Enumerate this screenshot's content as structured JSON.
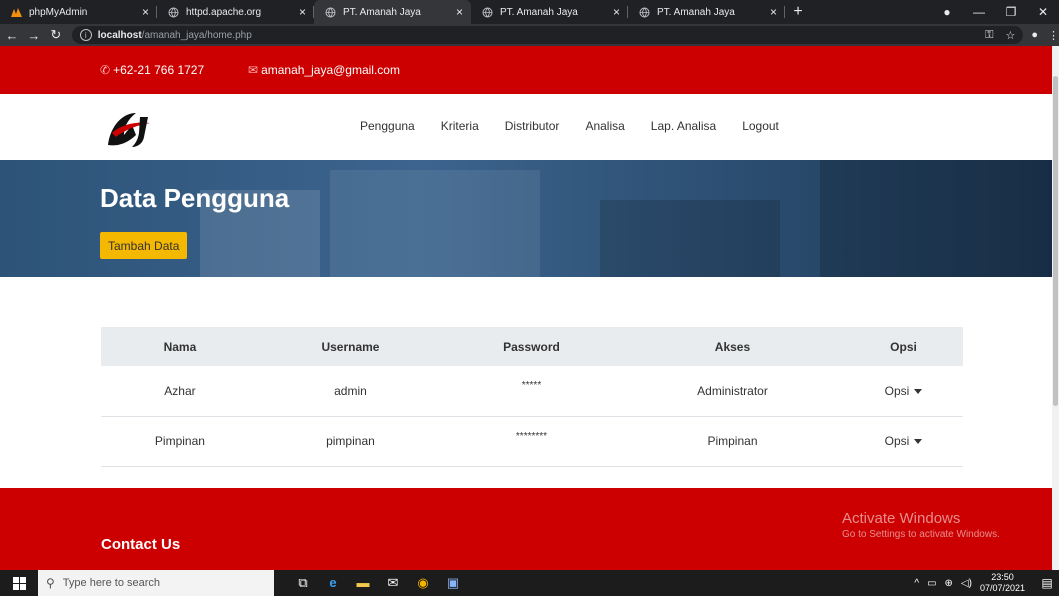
{
  "browser": {
    "tabs": [
      {
        "title": "phpMyAdmin",
        "icon": "phpmyadmin-icon",
        "active": false
      },
      {
        "title": "httpd.apache.org",
        "icon": "globe-icon",
        "active": false
      },
      {
        "title": "PT. Amanah Jaya",
        "icon": "globe-icon",
        "active": true
      },
      {
        "title": "PT. Amanah Jaya",
        "icon": "globe-icon",
        "active": false
      },
      {
        "title": "PT. Amanah Jaya",
        "icon": "globe-icon",
        "active": false
      }
    ],
    "close_glyph": "×",
    "new_tab_glyph": "+",
    "address": {
      "host": "localhost",
      "path": "/amanah_jaya/home.php"
    }
  },
  "site": {
    "phone": "+62-21 766 1727",
    "email": "amanah_jaya@gmail.com",
    "menu": [
      "Pengguna",
      "Kriteria",
      "Distributor",
      "Analisa",
      "Lap. Analisa",
      "Logout"
    ],
    "hero_title": "Data Pengguna",
    "add_button": "Tambah Data",
    "table": {
      "headers": [
        "Nama",
        "Username",
        "Password",
        "Akses",
        "Opsi"
      ],
      "rows": [
        {
          "nama": "Azhar",
          "username": "admin",
          "password": "*****",
          "akses": "Administrator",
          "opsi": "Opsi"
        },
        {
          "nama": "Pimpinan",
          "username": "pimpinan",
          "password": "********",
          "akses": "Pimpinan",
          "opsi": "Opsi"
        }
      ]
    },
    "footer_title": "Contact Us"
  },
  "watermark": {
    "line1": "Activate Windows",
    "line2": "Go to Settings to activate Windows."
  },
  "taskbar": {
    "search_placeholder": "Type here to search",
    "time": "23:50",
    "date": "07/07/2021"
  },
  "colors": {
    "brand_red": "#cc0000",
    "accent_yellow": "#f5b800",
    "hero_blue": "#2d5378"
  }
}
